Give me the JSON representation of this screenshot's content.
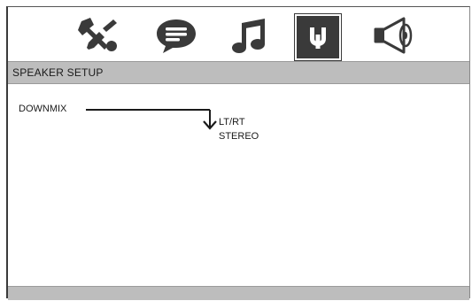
{
  "icons": [
    {
      "name": "wrench-screwdriver-icon",
      "active": false
    },
    {
      "name": "speech-bubble-icon",
      "active": false
    },
    {
      "name": "music-note-icon",
      "active": false
    },
    {
      "name": "speaker-setup-icon",
      "active": true
    },
    {
      "name": "speaker-volume-icon",
      "active": false
    }
  ],
  "section": {
    "title": "SPEAKER SETUP"
  },
  "menu": {
    "downmix_label": "DOWNMIX",
    "options": [
      "LT/RT",
      "STEREO"
    ]
  },
  "colors": {
    "bar": "#bdbdbd",
    "icon": "#3a3a3a",
    "background": "#ffffff"
  }
}
